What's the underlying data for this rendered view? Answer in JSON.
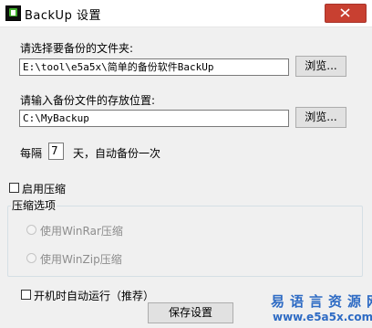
{
  "window": {
    "title": "BackUp  设置",
    "close_glyph": "✕"
  },
  "source": {
    "label": "请选择要备份的文件夹:",
    "value": "E:\\tool\\e5a5x\\简单的备份软件BackUp",
    "browse_label": "浏览..."
  },
  "destination": {
    "label": "请输入备份文件的存放位置:",
    "value": "C:\\MyBackup",
    "browse_label": "浏览..."
  },
  "interval": {
    "prefix": "每隔",
    "days": "7",
    "suffix": "天，自动备份一次"
  },
  "compression": {
    "enable_label": "启用压缩",
    "enabled": false,
    "options_title": "压缩选项",
    "options": [
      {
        "label": "使用WinRar压缩",
        "selected": false
      },
      {
        "label": "使用WinZip压缩",
        "selected": false
      }
    ]
  },
  "startup": {
    "label": "开机时自动运行（推荐）",
    "checked": false
  },
  "save_button": "保存设置",
  "watermark": {
    "text": "易语言资源网",
    "url": "www.e5a5x.com",
    "color": "#2e6bc4"
  },
  "colors": {
    "close_button": "#c84031",
    "window_bg": "#f0f0f0"
  }
}
